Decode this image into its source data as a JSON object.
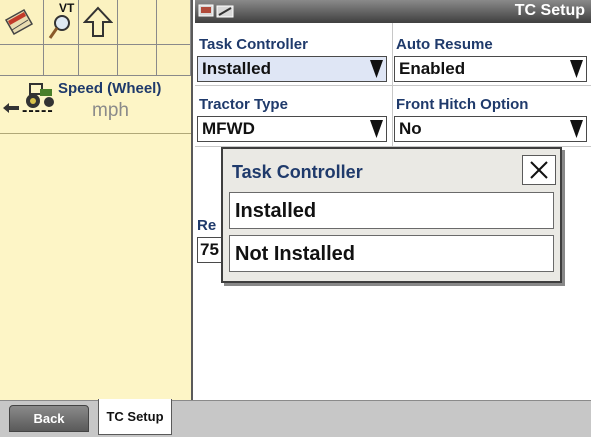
{
  "toolbar": {
    "vt_label": "VT",
    "icons": [
      "vt-icon",
      "up-arrow-icon",
      "key-icon",
      "settings-icon"
    ]
  },
  "sidebar": {
    "speed_label": "Speed (Wheel)",
    "speed_value": "-----",
    "speed_unit": "mph",
    "icon": "tractor-icon"
  },
  "header": {
    "title": "TC Setup"
  },
  "fields": {
    "task_controller": {
      "label": "Task Controller",
      "value": "Installed"
    },
    "auto_resume": {
      "label": "Auto Resume",
      "value": "Enabled"
    },
    "tractor_type": {
      "label": "Tractor Type",
      "value": "MFWD"
    },
    "front_hitch": {
      "label": "Front Hitch Option",
      "value": "No"
    },
    "partial_field": {
      "label": "Re",
      "value": "75"
    }
  },
  "modal": {
    "title": "Task Controller",
    "options": [
      "Installed",
      "Not Installed"
    ]
  },
  "tabs": {
    "back": "Back",
    "current": "TC Setup"
  },
  "colors": {
    "sidebar_bg": "#fdf5c6",
    "label_blue": "#1f3a6b",
    "highlight": "#dfe6f5",
    "modal_bg": "#eae9e4"
  }
}
